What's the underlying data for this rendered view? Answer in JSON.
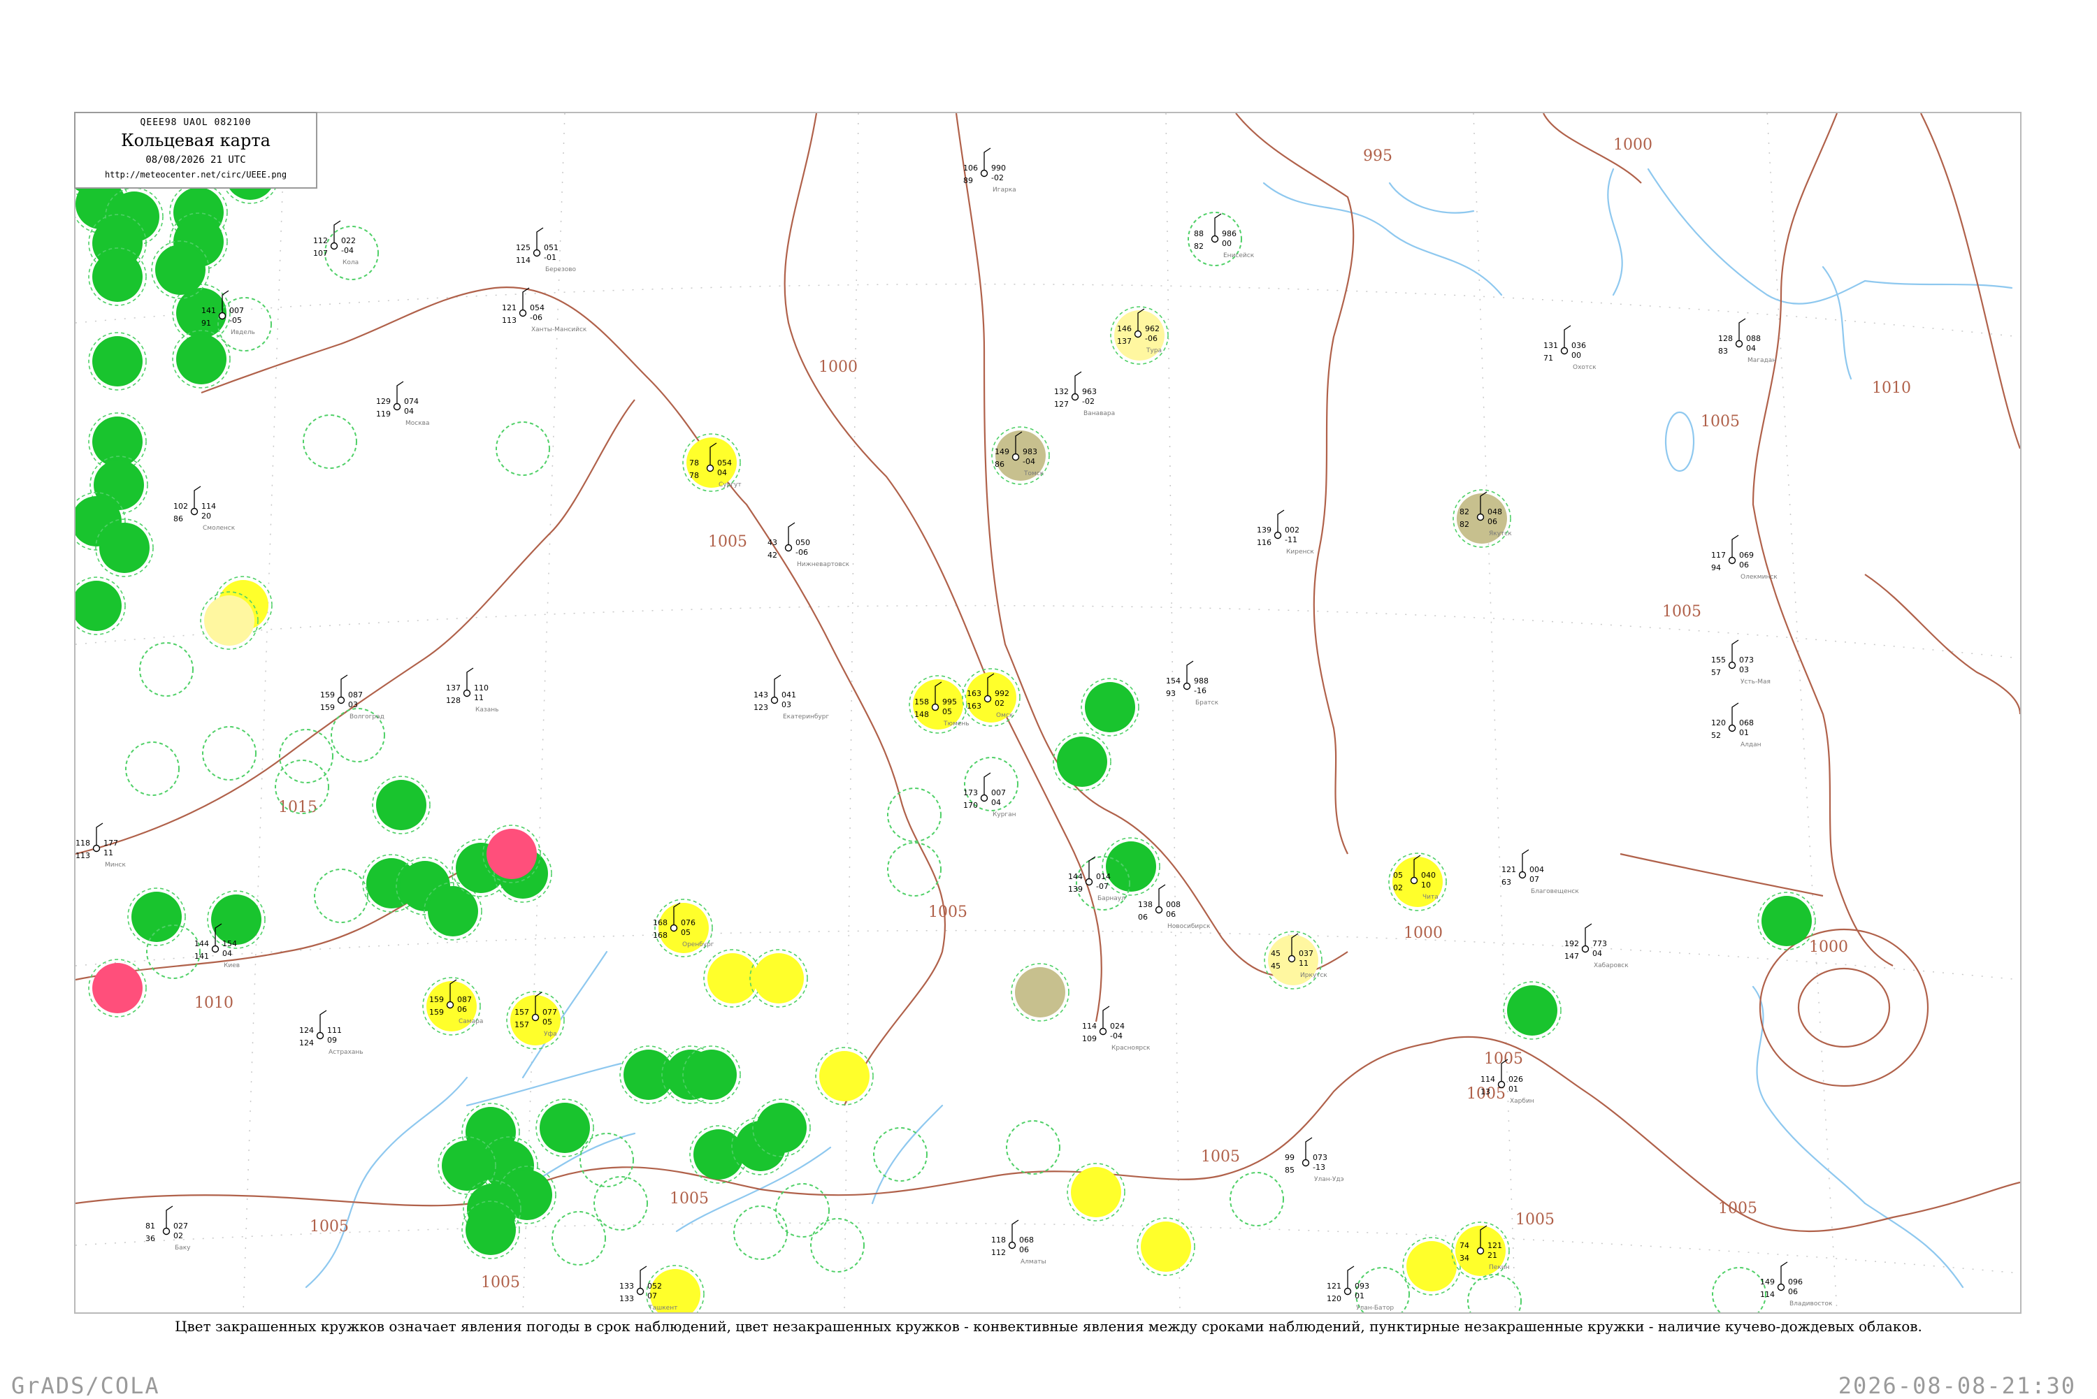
{
  "header": {
    "code": "QEEE98  UAOL  082100",
    "title": "Кольцевая карта",
    "date": "08/08/2026 21 UTC",
    "url": "http://meteocenter.net/circ/UEEE.png"
  },
  "caption": "Цвет закрашенных кружков означает явления погоды в срок наблюдений, цвет незакрашенных кружков - конвективные явления между сроками наблюдений, пунктирные незакрашенные кружки - наличие кучево-дождевых облаков.",
  "footer": {
    "left": "GrADS/COLA",
    "right": "2026-08-08-21:30"
  },
  "colors": {
    "isobar": "#b0614a",
    "river": "#8ec8ef",
    "rain": "#19c42e",
    "thunder": "#ff4f7b",
    "fog": "#ffff2b",
    "haze": "#fff7a0",
    "smoke": "#c7c08e",
    "cb_dashed": "#4fd067"
  },
  "isobar_labels": [
    "995",
    "1000",
    "1000",
    "1000",
    "1005",
    "1005",
    "1005",
    "1005",
    "1005",
    "1005",
    "1005",
    "1005",
    "1005",
    "1005",
    "1005",
    "1005",
    "1010",
    "1010",
    "1015",
    "1000"
  ],
  "stations": [
    {
      "id": "kola",
      "name": "Кола",
      "t": "112",
      "p": "022",
      "td": "107",
      "c": "-04"
    },
    {
      "id": "ivdel",
      "name": "Ивдель",
      "t": "141",
      "p": "007",
      "td": "91",
      "c": "-05"
    },
    {
      "id": "berezovo",
      "name": "Березово",
      "t": "125",
      "p": "051",
      "td": "114",
      "c": "-01"
    },
    {
      "id": "khanty",
      "name": "Ханты-Мансийск",
      "t": "121",
      "p": "054",
      "td": "113",
      "c": "-06"
    },
    {
      "id": "surgut",
      "name": "Сургут",
      "t": "78",
      "p": "054",
      "td": "78",
      "c": "04"
    },
    {
      "id": "nizhnevartovsk",
      "name": "Нижневартовск",
      "t": "43",
      "p": "050",
      "td": "42",
      "c": "-06"
    },
    {
      "id": "tyumen",
      "name": "Тюмень",
      "t": "158",
      "p": "995",
      "td": "148",
      "c": "05"
    },
    {
      "id": "omsk",
      "name": "Омск",
      "t": "163",
      "p": "992",
      "td": "163",
      "c": "02"
    },
    {
      "id": "tomsk",
      "name": "Томск",
      "t": "149",
      "p": "983",
      "td": "86",
      "c": "-04"
    },
    {
      "id": "tura",
      "name": "Тура",
      "t": "146",
      "p": "962",
      "td": "137",
      "c": "-06"
    },
    {
      "id": "eniseysk",
      "name": "Енисейск",
      "t": "88",
      "p": "986",
      "td": "82",
      "c": "00"
    },
    {
      "id": "igarka",
      "name": "Игарка",
      "t": "106",
      "p": "990",
      "td": "89",
      "c": "-02"
    },
    {
      "id": "vanavara",
      "name": "Ванавара",
      "t": "132",
      "p": "963",
      "td": "127",
      "c": "-02"
    },
    {
      "id": "kirensk",
      "name": "Киренск",
      "t": "139",
      "p": "002",
      "td": "116",
      "c": "-11"
    },
    {
      "id": "bratsk",
      "name": "Братск",
      "t": "154",
      "p": "988",
      "td": "93",
      "c": "-16"
    },
    {
      "id": "irkutsk",
      "name": "Иркутск",
      "t": "45",
      "p": "037",
      "td": "45",
      "c": "11"
    },
    {
      "id": "chita",
      "name": "Чита",
      "t": "05",
      "p": "040",
      "td": "02",
      "c": "10"
    },
    {
      "id": "yakutsk",
      "name": "Якутск",
      "t": "82",
      "p": "048",
      "td": "82",
      "c": "06"
    },
    {
      "id": "olekminsk",
      "name": "Олекминск",
      "t": "117",
      "p": "069",
      "td": "94",
      "c": "06"
    },
    {
      "id": "ust-maya",
      "name": "Усть-Мая",
      "t": "155",
      "p": "073",
      "td": "57",
      "c": "03"
    },
    {
      "id": "aldan",
      "name": "Алдан",
      "t": "120",
      "p": "068",
      "td": "52",
      "c": "01"
    },
    {
      "id": "blagoveshchensk",
      "name": "Благовещенск",
      "t": "121",
      "p": "004",
      "td": "63",
      "c": "07"
    },
    {
      "id": "khabarovsk",
      "name": "Хабаровск",
      "t": "192",
      "p": "773",
      "td": "147",
      "c": "04"
    },
    {
      "id": "vladivostok",
      "name": "Владивосток",
      "t": "149",
      "p": "096",
      "td": "114",
      "c": "06"
    },
    {
      "id": "magadan",
      "name": "Магадан",
      "t": "128",
      "p": "088",
      "td": "83",
      "c": "04"
    },
    {
      "id": "okhotsk",
      "name": "Охотск",
      "t": "131",
      "p": "036",
      "td": "71",
      "c": "00"
    },
    {
      "id": "kazan",
      "name": "Казань",
      "t": "137",
      "p": "110",
      "td": "128",
      "c": "11"
    },
    {
      "id": "samara",
      "name": "Самара",
      "t": "159",
      "p": "087",
      "td": "159",
      "c": "06"
    },
    {
      "id": "orenburg",
      "name": "Оренбург",
      "t": "168",
      "p": "076",
      "td": "168",
      "c": "05"
    },
    {
      "id": "ekaterinburg",
      "name": "Екатеринбург",
      "t": "143",
      "p": "041",
      "td": "123",
      "c": "03"
    },
    {
      "id": "ufa",
      "name": "Уфа",
      "t": "157",
      "p": "077",
      "td": "157",
      "c": "05"
    },
    {
      "id": "kurgan",
      "name": "Курган",
      "t": "173",
      "p": "007",
      "td": "170",
      "c": "04"
    },
    {
      "id": "barnaul",
      "name": "Барнаул",
      "t": "144",
      "p": "014",
      "td": "139",
      "c": "-07"
    },
    {
      "id": "novosibirsk",
      "name": "Новосибирск",
      "t": "138",
      "p": "008",
      "td": "06",
      "c": "06"
    },
    {
      "id": "krasnoyarsk",
      "name": "Красноярск",
      "t": "114",
      "p": "024",
      "td": "109",
      "c": "-04"
    },
    {
      "id": "ulan-ude",
      "name": "Улан-Удэ",
      "t": "99",
      "p": "073",
      "td": "85",
      "c": "-13"
    },
    {
      "id": "moscow",
      "name": "Москва",
      "t": "129",
      "p": "074",
      "td": "119",
      "c": "04"
    },
    {
      "id": "smolensk",
      "name": "Смоленск",
      "t": "102",
      "p": "114",
      "td": "86",
      "c": "20"
    },
    {
      "id": "minsk",
      "name": "Минск",
      "t": "118",
      "p": "177",
      "td": "113",
      "c": "11"
    },
    {
      "id": "kyiv",
      "name": "Киев",
      "t": "144",
      "p": "154",
      "td": "141",
      "c": "04"
    },
    {
      "id": "volgograd",
      "name": "Волгоград",
      "t": "159",
      "p": "087",
      "td": "159",
      "c": "03"
    },
    {
      "id": "astrakhan",
      "name": "Астрахань",
      "t": "124",
      "p": "111",
      "td": "124",
      "c": "09"
    },
    {
      "id": "baku",
      "name": "Баку",
      "t": "81",
      "p": "027",
      "td": "36",
      "c": "02"
    },
    {
      "id": "tashkent",
      "name": "Ташкент",
      "t": "133",
      "p": "052",
      "td": "133",
      "c": "07"
    },
    {
      "id": "almaty",
      "name": "Алматы",
      "t": "118",
      "p": "068",
      "td": "112",
      "c": "06"
    },
    {
      "id": "ulaanbaatar",
      "name": "Улан-Батор",
      "t": "121",
      "p": "093",
      "td": "120",
      "c": "01"
    },
    {
      "id": "beijing",
      "name": "Пекин",
      "t": "74",
      "p": "121",
      "td": "34",
      "c": "21"
    },
    {
      "id": "harbin",
      "name": "Харбин",
      "t": "114",
      "p": "026",
      "td": "13",
      "c": "01"
    }
  ]
}
